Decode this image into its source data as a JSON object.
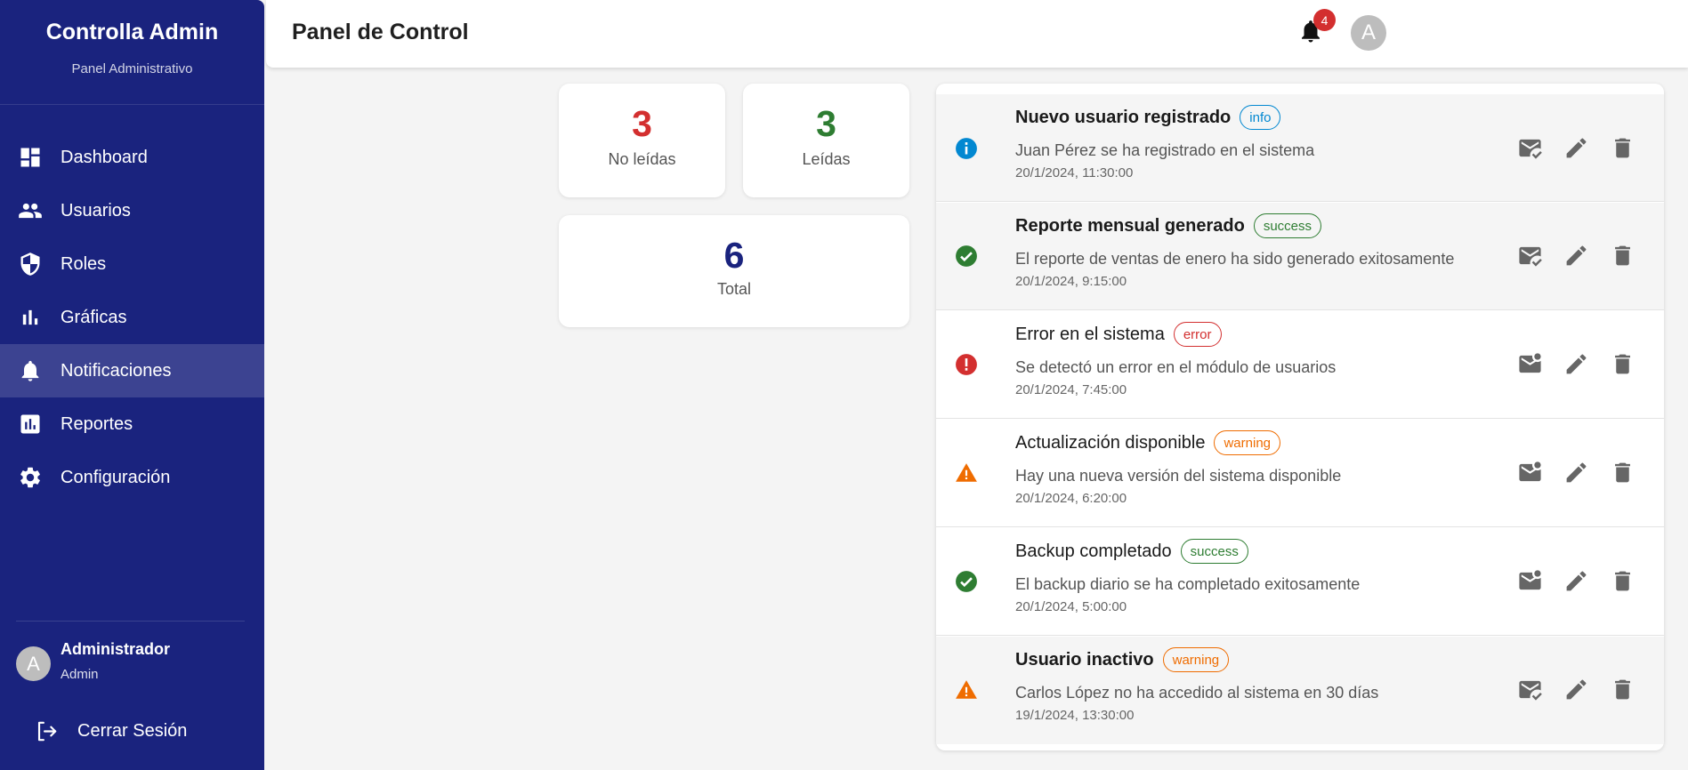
{
  "sidebar": {
    "brand_title": "Controlla Admin",
    "brand_subtitle": "Panel Administrativo",
    "items": [
      {
        "label": "Dashboard",
        "icon": "dashboard-icon"
      },
      {
        "label": "Usuarios",
        "icon": "people-icon"
      },
      {
        "label": "Roles",
        "icon": "shield-icon"
      },
      {
        "label": "Gráficas",
        "icon": "bar-chart-icon"
      },
      {
        "label": "Notificaciones",
        "icon": "bell-icon",
        "active": true
      },
      {
        "label": "Reportes",
        "icon": "report-icon"
      },
      {
        "label": "Configuración",
        "icon": "gear-icon"
      }
    ],
    "user": {
      "avatar_letter": "A",
      "name": "Administrador",
      "role": "Admin"
    },
    "logout_label": "Cerrar Sesión"
  },
  "header": {
    "title": "Panel de Control",
    "notification_count": "4",
    "avatar_letter": "A"
  },
  "stats": {
    "unread": {
      "value": "3",
      "label": "No leídas",
      "color": "#d32f2f"
    },
    "read": {
      "value": "3",
      "label": "Leídas",
      "color": "#2e7d32"
    },
    "total": {
      "value": "6",
      "label": "Total",
      "color": "#1a237e"
    }
  },
  "notifications": [
    {
      "title": "Nuevo usuario registrado",
      "type": "info",
      "message": "Juan Pérez se ha registrado en el sistema",
      "time": "20/1/2024, 11:30:00",
      "unread": true
    },
    {
      "title": "Reporte mensual generado",
      "type": "success",
      "message": "El reporte de ventas de enero ha sido generado exitosamente",
      "time": "20/1/2024, 9:15:00",
      "unread": true
    },
    {
      "title": "Error en el sistema",
      "type": "error",
      "message": "Se detectó un error en el módulo de usuarios",
      "time": "20/1/2024, 7:45:00",
      "unread": false
    },
    {
      "title": "Actualización disponible",
      "type": "warning",
      "message": "Hay una nueva versión del sistema disponible",
      "time": "20/1/2024, 6:20:00",
      "unread": false
    },
    {
      "title": "Backup completado",
      "type": "success",
      "message": "El backup diario se ha completado exitosamente",
      "time": "20/1/2024, 5:00:00",
      "unread": false
    },
    {
      "title": "Usuario inactivo",
      "type": "warning",
      "message": "Carlos López no ha accedido al sistema en 30 días",
      "time": "19/1/2024, 13:30:00",
      "unread": true
    }
  ],
  "colors": {
    "sidebar_bg": "#1a237e",
    "info": "#0288d1",
    "success": "#2e7d32",
    "error": "#d32f2f",
    "warning": "#ef6c00"
  }
}
